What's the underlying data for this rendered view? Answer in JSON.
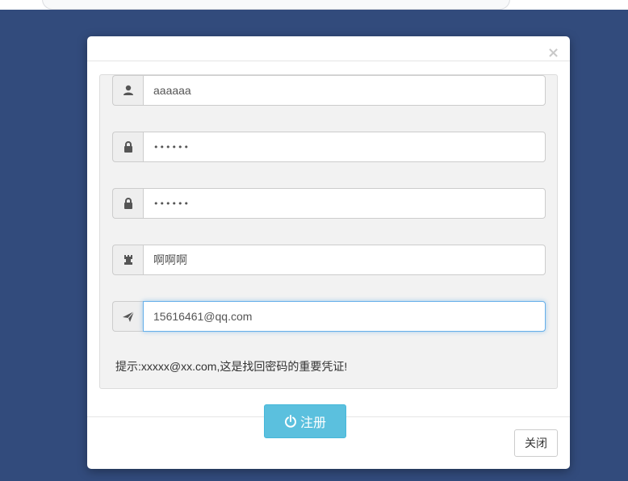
{
  "modal": {
    "close_symbol": "×",
    "fields": [
      {
        "name": "username",
        "icon": "user-icon",
        "value": "aaaaaa"
      },
      {
        "name": "password",
        "icon": "lock-icon",
        "value": "••••••"
      },
      {
        "name": "confirm_password",
        "icon": "lock-icon",
        "value": "••••••"
      },
      {
        "name": "nickname",
        "icon": "tower-icon",
        "value": "啊啊啊"
      },
      {
        "name": "email",
        "icon": "send-icon",
        "value": "15616461@qq.com"
      }
    ],
    "hint": "提示:xxxxx@xx.com,这是找回密码的重要凭证!",
    "register_label": "注册",
    "close_label": "关闭"
  },
  "colors": {
    "background": "#324b7c",
    "primary_button": "#5bc0de",
    "focus_border": "#66afe9"
  }
}
